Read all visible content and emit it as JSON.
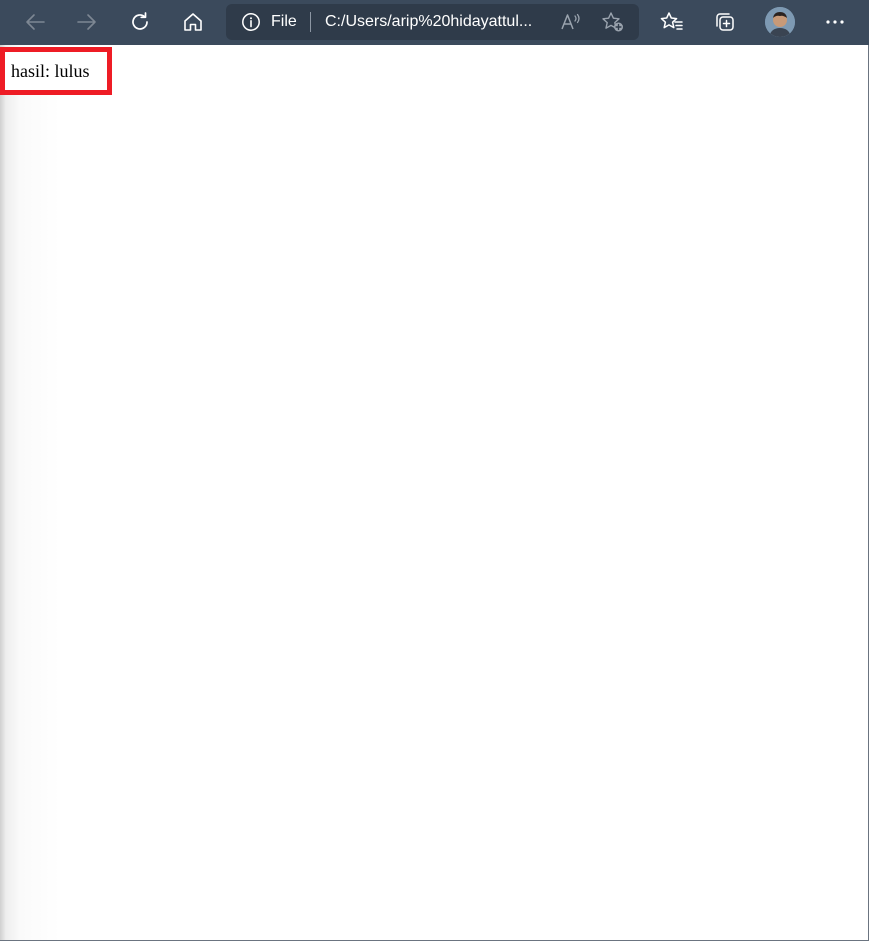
{
  "browser": {
    "address_bar": {
      "scheme_label": "File",
      "url": "C:/Users/arip%20hidayattul..."
    },
    "toolbar_icons": {
      "back": "back-arrow-icon",
      "forward": "forward-arrow-icon",
      "refresh": "refresh-icon",
      "home": "home-icon",
      "info": "info-icon",
      "read_aloud": "read-aloud-icon",
      "add_favorite": "add-favorite-icon",
      "favorites": "favorites-icon",
      "collections": "collections-icon",
      "profile": "profile-avatar",
      "more": "more-icon"
    },
    "colors": {
      "toolbar": "#3b4a5c",
      "address_bar": "#2f3b4a",
      "highlight": "#ee1c25"
    }
  },
  "page": {
    "result_text": "hasil: lulus"
  }
}
